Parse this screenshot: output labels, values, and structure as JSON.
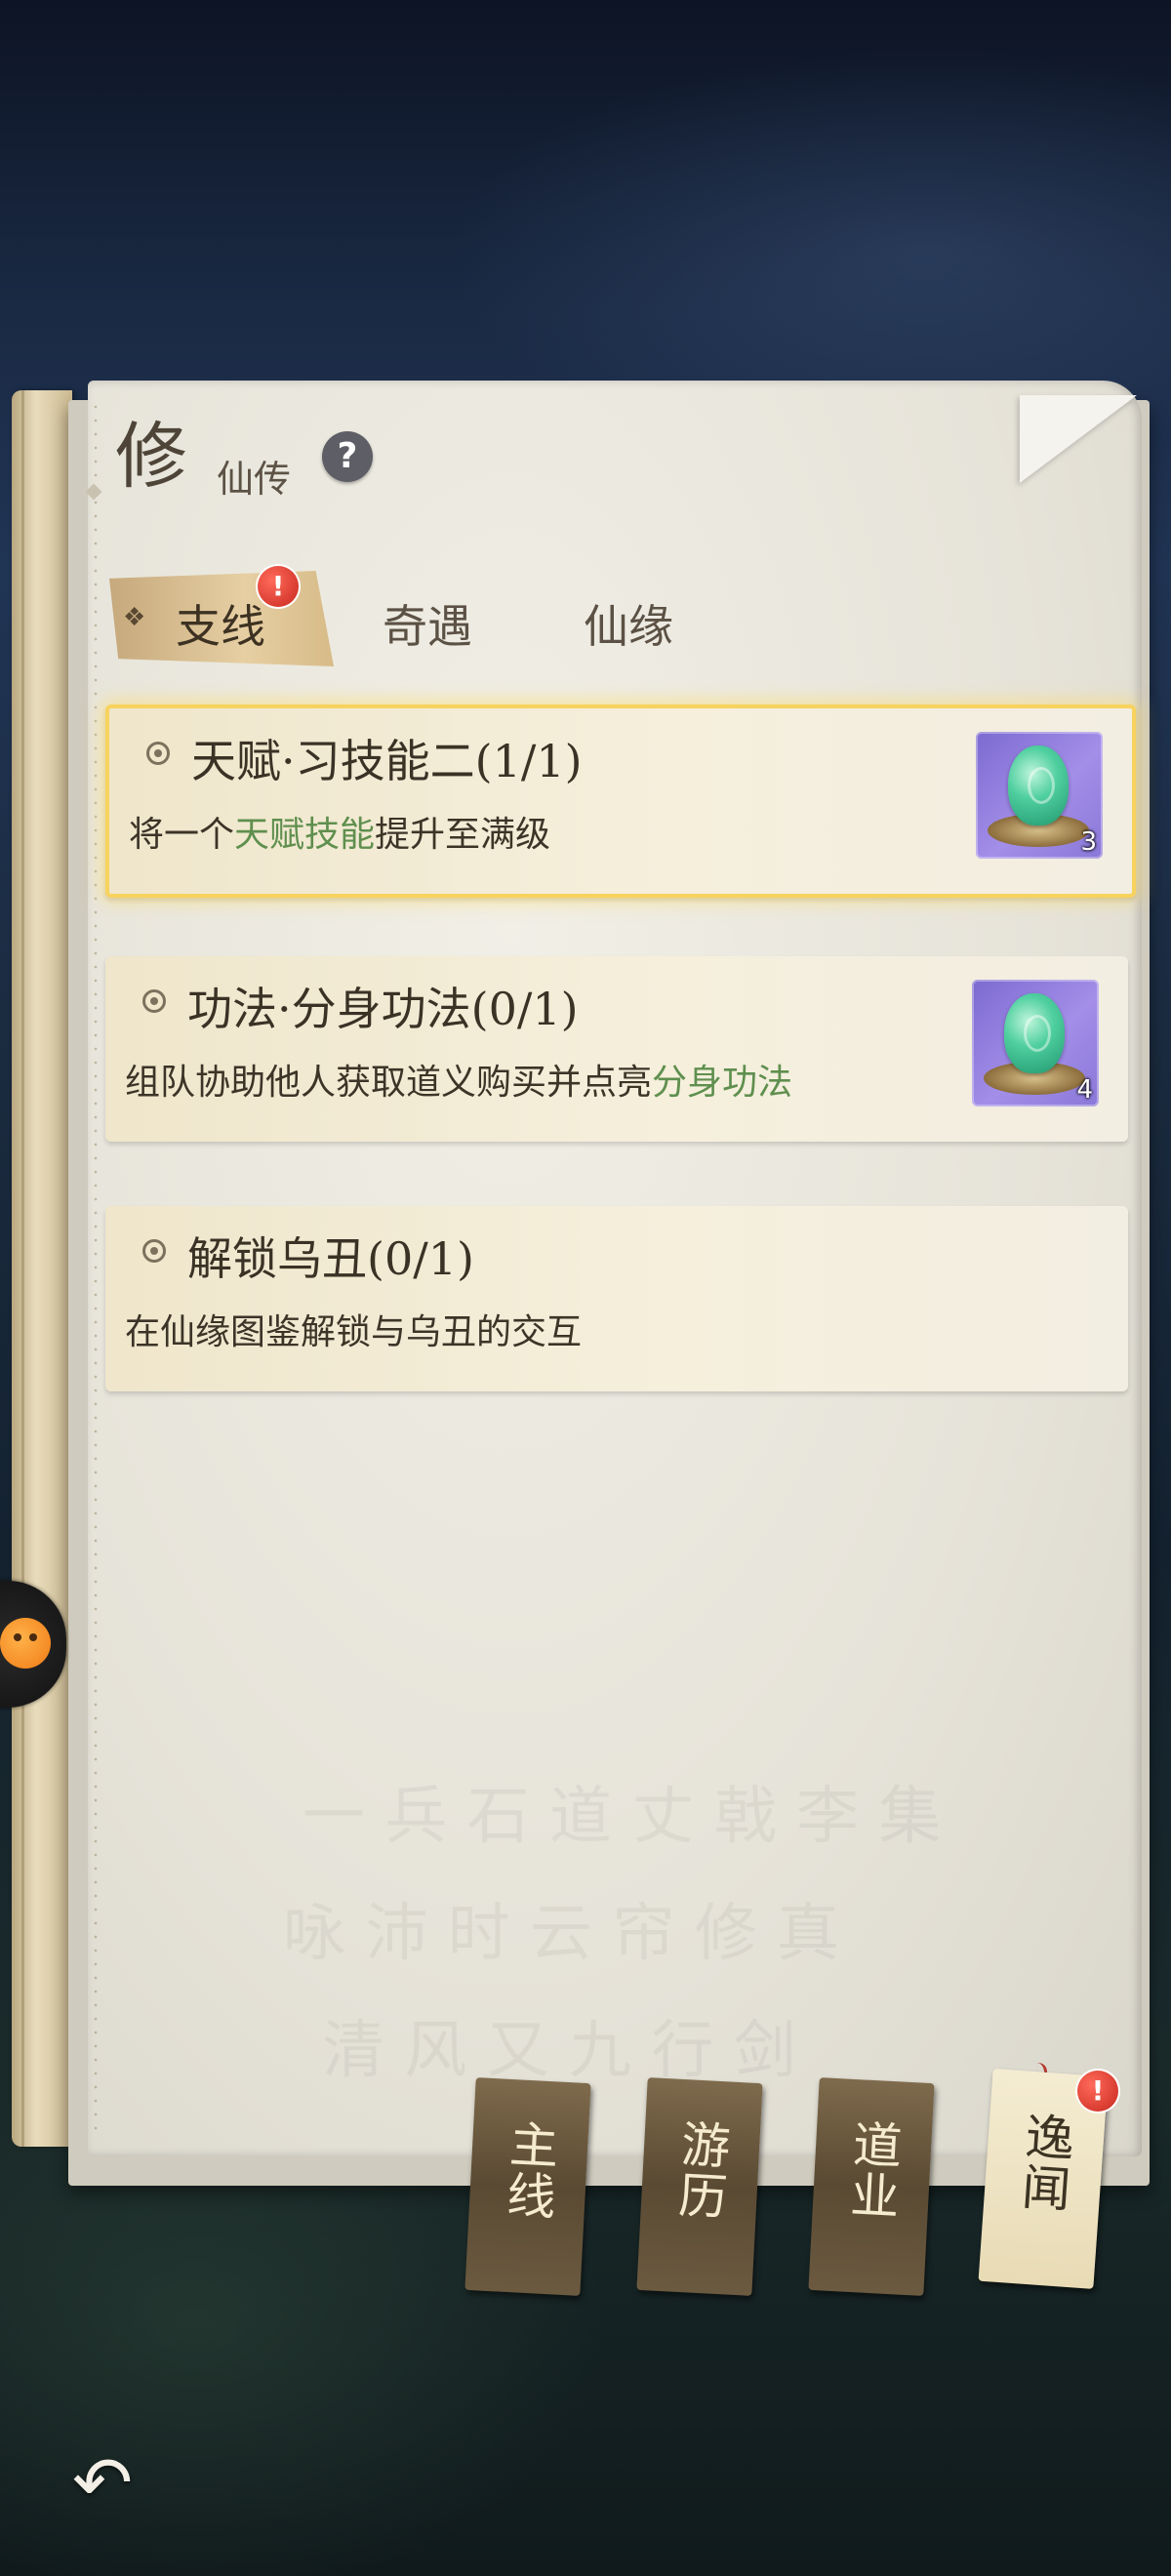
{
  "header": {
    "title_big": "修",
    "title_small": "仙传",
    "help_label": "?"
  },
  "tabs": [
    {
      "label": "支线",
      "active": true,
      "badge": "!"
    },
    {
      "label": "奇遇",
      "active": false
    },
    {
      "label": "仙缘",
      "active": false
    }
  ],
  "tasks": [
    {
      "title": "天赋·习技能二(1/1)",
      "desc_before": "将一个",
      "desc_highlight": "天赋技能",
      "desc_after": "提升至满级",
      "reward": {
        "icon": "jade-pendant-icon",
        "count": "3"
      },
      "highlighted": true
    },
    {
      "title": "功法·分身功法(0/1)",
      "desc_before": "组队协助他人获取道义购买并点亮",
      "desc_highlight": "分身功法",
      "desc_after": "",
      "reward": {
        "icon": "jade-pendant-icon",
        "count": "4"
      },
      "highlighted": false
    },
    {
      "title": "解锁乌丑(0/1)",
      "desc_before": "在仙缘图鉴解锁与乌丑的交互",
      "desc_highlight": "",
      "desc_after": "",
      "highlighted": false
    }
  ],
  "categories": [
    {
      "label": "主线",
      "active": false
    },
    {
      "label": "游历",
      "active": false
    },
    {
      "label": "道业",
      "active": false
    },
    {
      "label": "逸闻",
      "active": true,
      "badge": "!"
    }
  ],
  "colors": {
    "accent_green": "#5f8f4e",
    "badge_red": "#d8362a",
    "highlight_gold": "#f7d35e"
  }
}
